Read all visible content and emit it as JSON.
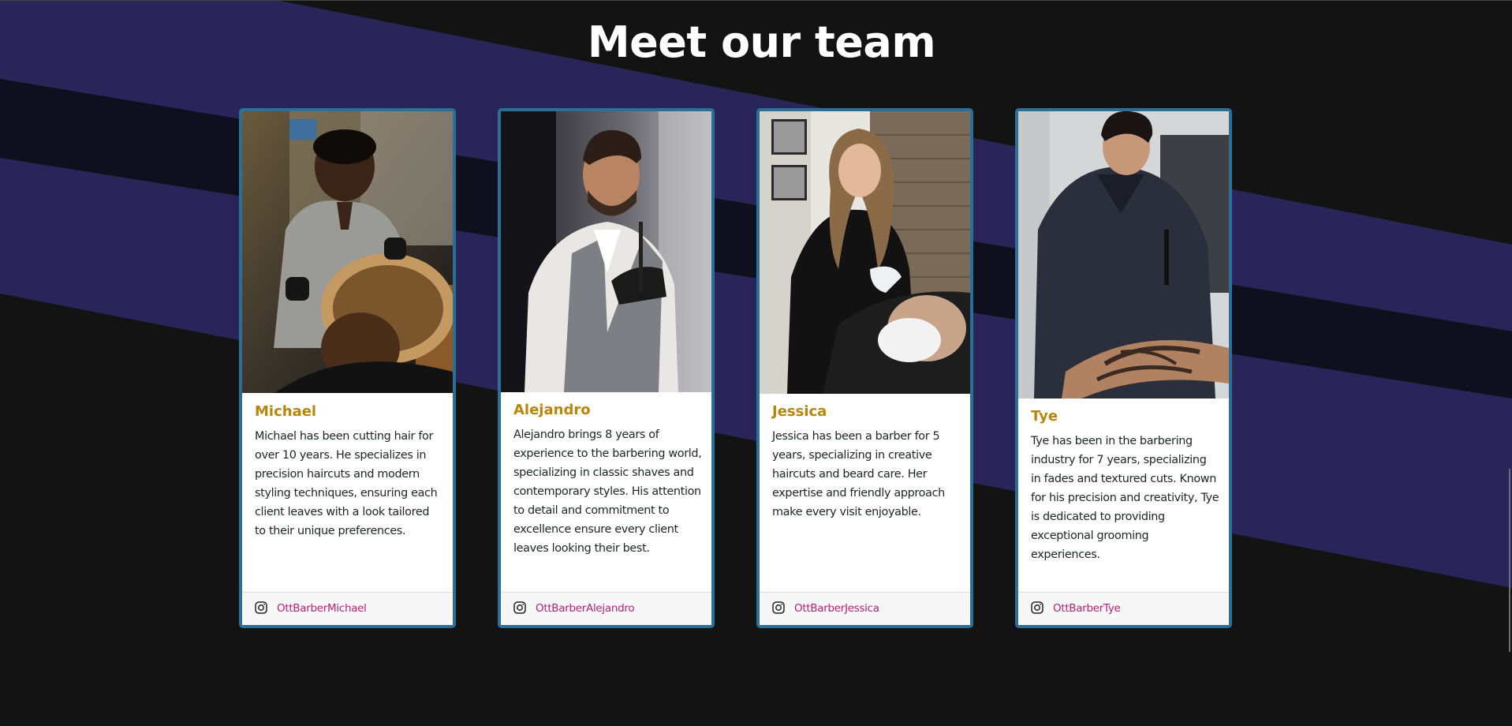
{
  "page": {
    "heading": "Meet our team"
  },
  "colors": {
    "background": "#141313",
    "stripe_purple": "#2a2558",
    "stripe_dark": "#100f1d",
    "card_border": "#2a6f98",
    "name_gold": "#b8860b",
    "instagram_link": "#b3227a"
  },
  "team": [
    {
      "name": "Michael",
      "bio": "Michael has been cutting hair for over 10 years. He specializes in precision haircuts and modern styling techniques, ensuring each client leaves with a look tailored to their unique preferences.",
      "instagram": "OttBarberMichael",
      "icon": "instagram-icon",
      "photo": "barber-michael-photo"
    },
    {
      "name": "Alejandro",
      "bio": "Alejandro brings 8 years of experience to the barbering world, specializing in classic shaves and contemporary styles. His attention to detail and commitment to excellence ensure every client leaves looking their best.",
      "instagram": "OttBarberAlejandro",
      "icon": "instagram-icon",
      "photo": "barber-alejandro-photo"
    },
    {
      "name": "Jessica",
      "bio": "Jessica has been a barber for 5 years, specializing in creative haircuts and beard care. Her expertise and friendly approach make every visit enjoyable.",
      "instagram": "OttBarberJessica",
      "icon": "instagram-icon",
      "photo": "barber-jessica-photo"
    },
    {
      "name": "Tye",
      "bio": "Tye has been in the barbering industry for 7 years, specializing in fades and textured cuts. Known for his precision and creativity, Tye is dedicated to providing exceptional grooming experiences.",
      "instagram": "OttBarberTye",
      "icon": "instagram-icon",
      "photo": "barber-tye-photo"
    }
  ]
}
